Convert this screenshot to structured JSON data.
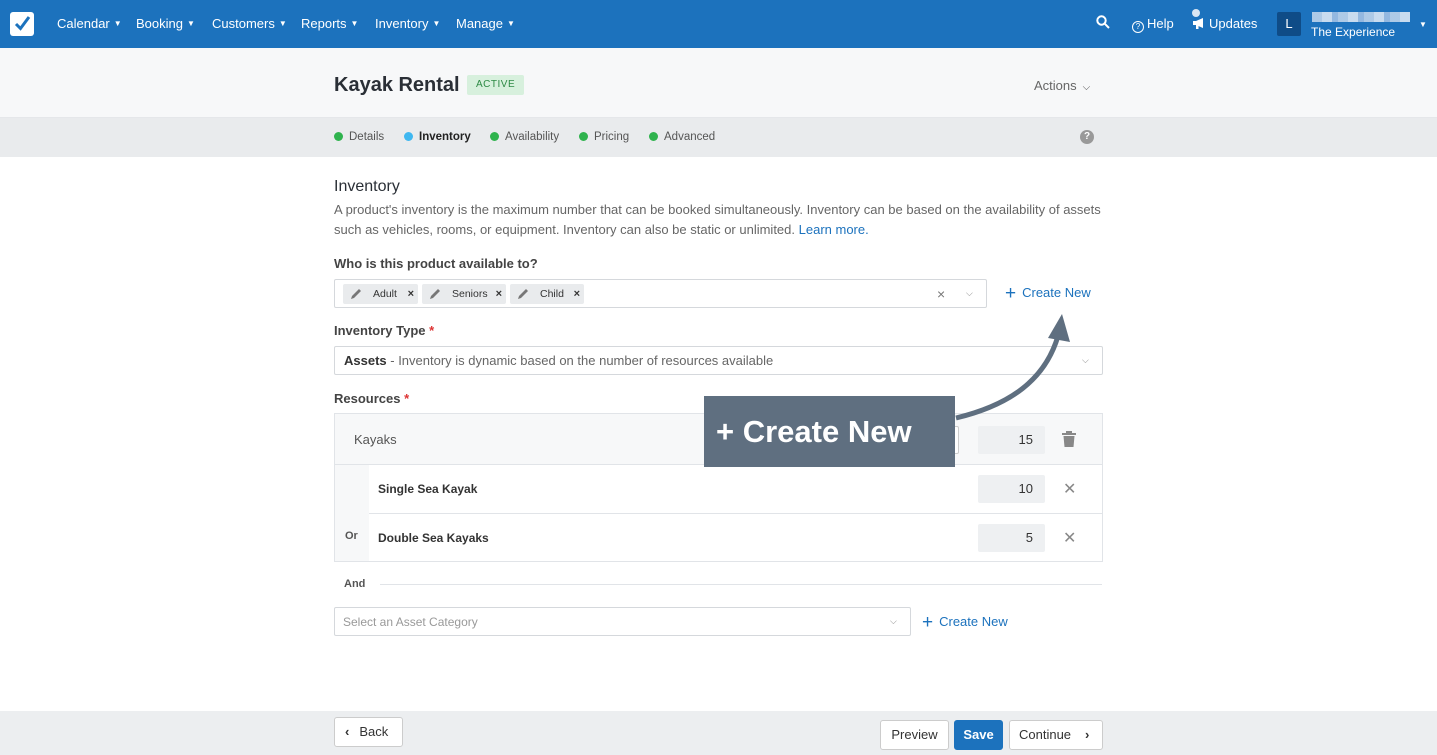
{
  "nav": {
    "items": [
      {
        "label": "Calendar"
      },
      {
        "label": "Booking"
      },
      {
        "label": "Customers"
      },
      {
        "label": "Reports"
      },
      {
        "label": "Inventory"
      },
      {
        "label": "Manage"
      }
    ],
    "help_label": "Help",
    "updates_label": "Updates",
    "avatar_initial": "L",
    "account_name": "The Experience"
  },
  "header": {
    "title": "Kayak Rental",
    "status": "ACTIVE",
    "actions_label": "Actions"
  },
  "steps": [
    {
      "label": "Details",
      "color": "#2fb34e"
    },
    {
      "label": "Inventory",
      "color": "#3fb7f0"
    },
    {
      "label": "Availability",
      "color": "#2fb34e"
    },
    {
      "label": "Pricing",
      "color": "#2fb34e"
    },
    {
      "label": "Advanced",
      "color": "#2fb34e"
    }
  ],
  "section": {
    "title": "Inventory",
    "description": "A product's inventory is the maximum number that can be booked simultaneously. Inventory can be based on the availability of assets such as vehicles, rooms, or equipment. Inventory can also be static or unlimited.",
    "learn_more": "Learn more."
  },
  "availability": {
    "label": "Who is this product available to?",
    "tags": [
      "Adult",
      "Seniors",
      "Child"
    ],
    "create_new": "Create New"
  },
  "inventory_type": {
    "label": "Inventory Type",
    "value_strong": "Assets",
    "value_rest": " - Inventory is dynamic based on the number of resources available"
  },
  "resources": {
    "label": "Resources",
    "group_name": "Kayaks",
    "group_total": "15",
    "rows": [
      {
        "name": "Single Sea Kayak",
        "qty": "10"
      },
      {
        "name": "Double Sea Kayaks",
        "qty": "5"
      }
    ],
    "or_label": "Or",
    "and_label": "And",
    "asset_placeholder": "Select an Asset Category",
    "create_new": "Create New"
  },
  "overlay": {
    "callout_text": "+ Create New"
  },
  "footer": {
    "back": "Back",
    "preview": "Preview",
    "save": "Save",
    "continue": "Continue"
  },
  "colors": {
    "brand": "#1c72bd",
    "active_badge_bg": "#d7f0dd",
    "callout_bg": "#5f6f80"
  }
}
